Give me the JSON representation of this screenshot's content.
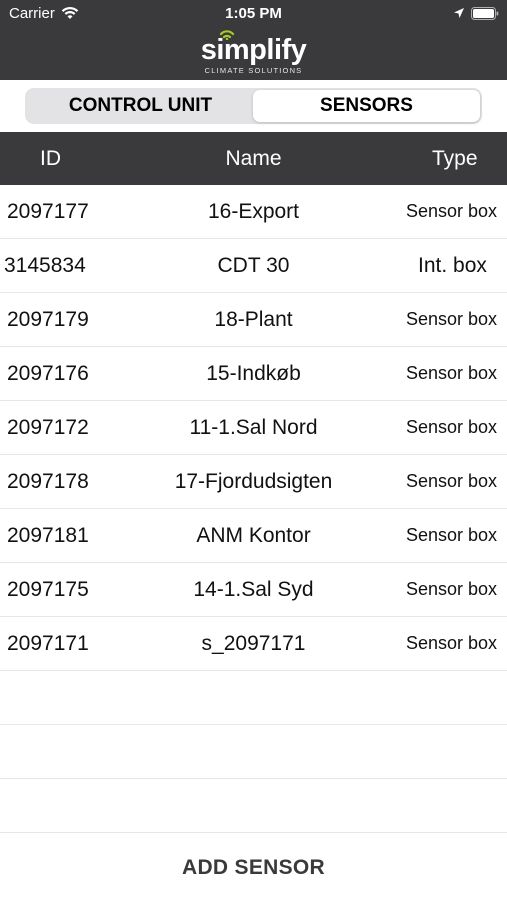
{
  "status_bar": {
    "carrier": "Carrier",
    "time": "1:05 PM"
  },
  "header": {
    "logo_text": "simplify",
    "logo_subtext": "CLIMATE SOLUTIONS",
    "accent_color": "#a6c829"
  },
  "segmented_control": {
    "options": [
      "CONTROL UNIT",
      "SENSORS"
    ],
    "selected": "SENSORS"
  },
  "table": {
    "columns": [
      "ID",
      "Name",
      "Type"
    ],
    "rows": [
      {
        "id": "2097177",
        "name": "16-Export",
        "type": "Sensor box"
      },
      {
        "id": "3145834",
        "name": "CDT 30",
        "type": "Int. box"
      },
      {
        "id": "2097179",
        "name": "18-Plant",
        "type": "Sensor box"
      },
      {
        "id": "2097176",
        "name": "15-Indkøb",
        "type": "Sensor box"
      },
      {
        "id": "2097172",
        "name": "11-1.Sal Nord",
        "type": "Sensor box"
      },
      {
        "id": "2097178",
        "name": "17-Fjordudsigten",
        "type": "Sensor box"
      },
      {
        "id": "2097181",
        "name": "ANM Kontor",
        "type": "Sensor box"
      },
      {
        "id": "2097175",
        "name": "14-1.Sal Syd",
        "type": "Sensor box"
      },
      {
        "id": "2097171",
        "name": "s_2097171",
        "type": "Sensor box"
      }
    ]
  },
  "footer": {
    "add_button_label": "ADD SENSOR"
  }
}
